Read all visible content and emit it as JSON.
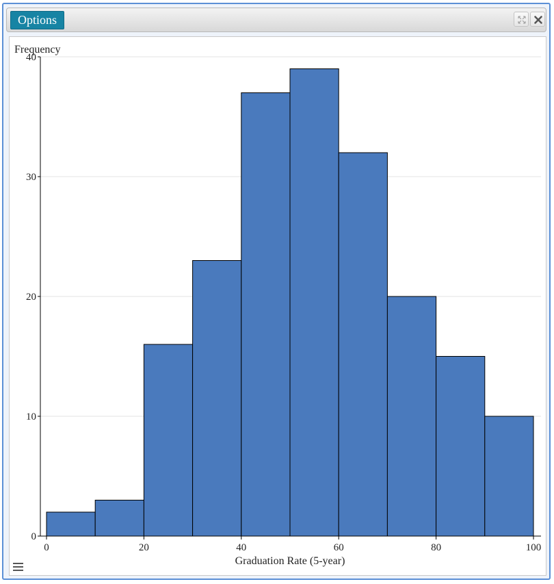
{
  "window": {
    "options_label": "Options",
    "expand_icon": "expand-icon",
    "close_icon": "close-icon",
    "menu_icon": "hamburger-menu-icon"
  },
  "colors": {
    "bar_fill": "#4a7abd",
    "bar_stroke": "#000000",
    "grid": "#e3e3e3",
    "options_bg": "#1784a4",
    "window_border": "#5b8fd6"
  },
  "chart_data": {
    "type": "bar",
    "title": "",
    "xlabel": "Graduation Rate (5-year)",
    "ylabel": "Frequency",
    "bins": [
      {
        "start": 0,
        "end": 10,
        "count": 2
      },
      {
        "start": 10,
        "end": 20,
        "count": 3
      },
      {
        "start": 20,
        "end": 30,
        "count": 16
      },
      {
        "start": 30,
        "end": 40,
        "count": 23
      },
      {
        "start": 40,
        "end": 50,
        "count": 37
      },
      {
        "start": 50,
        "end": 60,
        "count": 39
      },
      {
        "start": 60,
        "end": 70,
        "count": 32
      },
      {
        "start": 70,
        "end": 80,
        "count": 20
      },
      {
        "start": 80,
        "end": 90,
        "count": 15
      },
      {
        "start": 90,
        "end": 100,
        "count": 10
      }
    ],
    "xlim": [
      0,
      100
    ],
    "ylim": [
      0,
      40
    ],
    "xticks": [
      0,
      20,
      40,
      60,
      80,
      100
    ],
    "yticks": [
      0,
      10,
      20,
      30,
      40
    ],
    "grid": true
  }
}
